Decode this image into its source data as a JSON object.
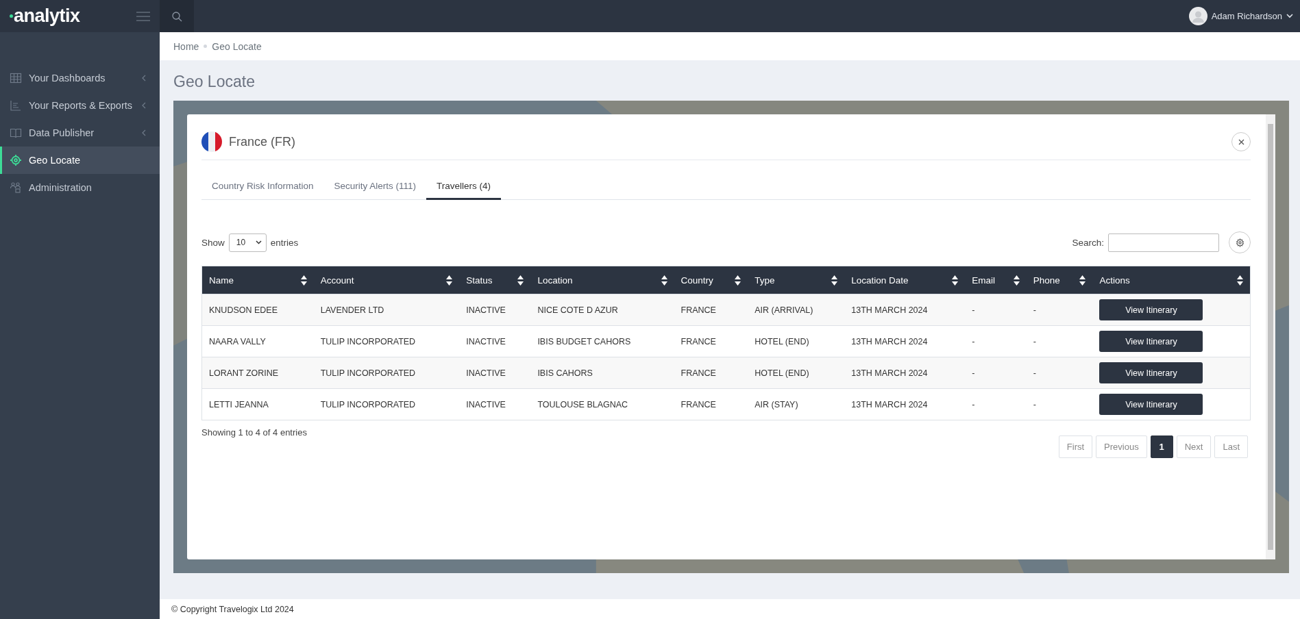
{
  "app": {
    "logo": "analytix"
  },
  "user": {
    "name": "Adam Richardson"
  },
  "sidebar": {
    "items": [
      {
        "label": "Your Dashboards",
        "expandable": true,
        "selected": false
      },
      {
        "label": "Your Reports & Exports",
        "expandable": true,
        "selected": false
      },
      {
        "label": "Data Publisher",
        "expandable": true,
        "selected": false
      },
      {
        "label": "Geo Locate",
        "expandable": false,
        "selected": true
      },
      {
        "label": "Administration",
        "expandable": false,
        "selected": false
      }
    ]
  },
  "breadcrumb": [
    "Home",
    "Geo Locate"
  ],
  "page_title": "Geo Locate",
  "modal": {
    "title": "France (FR)",
    "tabs": [
      {
        "label": "Country Risk Information",
        "selected": false
      },
      {
        "label": "Security Alerts (111)",
        "selected": false
      },
      {
        "label": "Travellers (4)",
        "selected": true
      }
    ],
    "length_menu": {
      "before": "Show",
      "value": "10",
      "after": "entries"
    },
    "search": {
      "label": "Search:"
    },
    "table": {
      "columns": [
        "Name",
        "Account",
        "Status",
        "Location",
        "Country",
        "Type",
        "Location Date",
        "Email",
        "Phone",
        "Actions"
      ],
      "rows": [
        {
          "cells": [
            "KNUDSON EDEE",
            "LAVENDER LTD",
            "INACTIVE",
            "NICE COTE D AZUR",
            "FRANCE",
            "AIR (ARRIVAL)",
            "13TH MARCH 2024",
            "-",
            "-"
          ],
          "action": "View Itinerary"
        },
        {
          "cells": [
            "NAARA VALLY",
            "TULIP INCORPORATED",
            "INACTIVE",
            "IBIS BUDGET CAHORS",
            "FRANCE",
            "HOTEL (END)",
            "13TH MARCH 2024",
            "-",
            "-"
          ],
          "action": "View Itinerary"
        },
        {
          "cells": [
            "LORANT ZORINE",
            "TULIP INCORPORATED",
            "INACTIVE",
            "IBIS CAHORS",
            "FRANCE",
            "HOTEL (END)",
            "13TH MARCH 2024",
            "-",
            "-"
          ],
          "action": "View Itinerary"
        },
        {
          "cells": [
            "LETTI JEANNA",
            "TULIP INCORPORATED",
            "INACTIVE",
            "TOULOUSE BLAGNAC",
            "FRANCE",
            "AIR (STAY)",
            "13TH MARCH 2024",
            "-",
            "-"
          ],
          "action": "View Itinerary"
        }
      ]
    },
    "info": "Showing 1 to 4 of 4 entries",
    "pagination": [
      {
        "label": "First",
        "selected": false
      },
      {
        "label": "Previous",
        "selected": false
      },
      {
        "label": "1",
        "selected": true
      },
      {
        "label": "Next",
        "selected": false
      },
      {
        "label": "Last",
        "selected": false
      }
    ]
  },
  "footer": "© Copyright Travelogix Ltd 2024"
}
